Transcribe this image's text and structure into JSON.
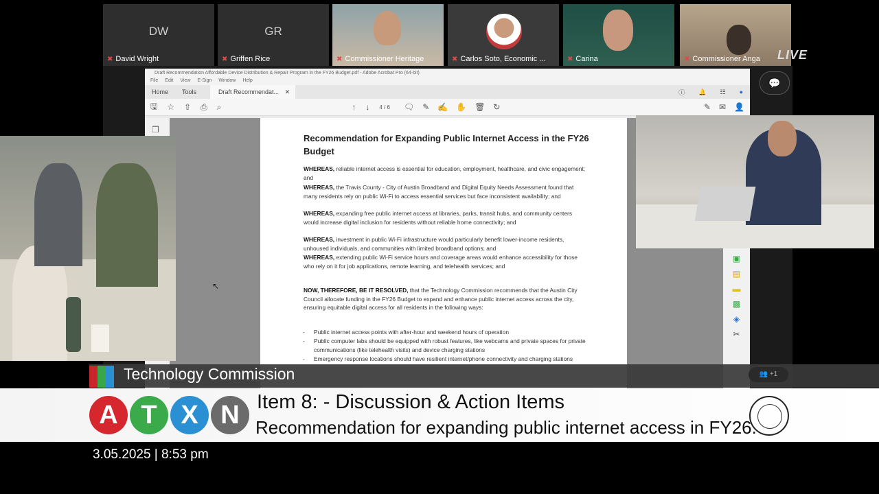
{
  "participants": [
    {
      "initials": "DW",
      "name": "David Wright"
    },
    {
      "initials": "GR",
      "name": "Griffen Rice"
    },
    {
      "initials": "",
      "name": "Commissioner Heritage"
    },
    {
      "initials": "",
      "name": "Carlos Soto, Economic ..."
    },
    {
      "initials": "",
      "name": "Carina"
    },
    {
      "initials": "",
      "name": "Commissioner Anga"
    }
  ],
  "live_label": "LIVE",
  "acrobat": {
    "window_title": "Draft Recommendation Affordable Device Distribution & Repair Program in the FY26 Budget.pdf - Adobe Acrobat Pro (64-bit)",
    "menu": [
      "File",
      "Edit",
      "View",
      "E-Sign",
      "Window",
      "Help"
    ],
    "tabs": {
      "home": "Home",
      "tools": "Tools",
      "doc": "Draft Recommendat..."
    },
    "page_indicator": "4 / 6"
  },
  "document": {
    "title": "Recommendation for Expanding Public Internet Access in the FY26 Budget",
    "whereas": [
      {
        "lead": "WHEREAS,",
        "text": " reliable internet access is essential for education, employment, healthcare, and civic engagement; and"
      },
      {
        "lead": "WHEREAS,",
        "text": " the Travis County - City of Austin Broadband and Digital Equity Needs Assessment found that many residents rely on public Wi-Fi to access essential services but face inconsistent availability; and"
      },
      {
        "lead": "WHEREAS,",
        "text": " expanding free public internet access at libraries, parks, transit hubs, and community centers would increase digital inclusion for residents without reliable home connectivity; and"
      },
      {
        "lead": "WHEREAS,",
        "text": " investment in public Wi-Fi infrastructure would particularly benefit lower-income residents, unhoused individuals, and communities with limited broadband options; and"
      },
      {
        "lead": "WHEREAS,",
        "text": " extending public Wi-Fi service hours and coverage areas would enhance accessibility for those who rely on it for job applications, remote learning, and telehealth services; and"
      }
    ],
    "resolved_lead": "NOW, THEREFORE, BE IT RESOLVED,",
    "resolved_text": " that the Technology Commission recommends that the Austin City Council allocate funding in the FY26 Budget to expand and enhance public internet access across the city, ensuring equitable digital access for all residents in the following ways:",
    "bullets": [
      "Public internet access points with after-hour and weekend hours of operation",
      "Public computer labs should be equipped with robust features, like webcams and private spaces for private communications (like telehealth visits) and device charging stations",
      "Emergency response locations should have resilient internet/phone connectivity and charging stations"
    ]
  },
  "lower_third": {
    "commission": "Technology Commission",
    "logo_letters": [
      "A",
      "T",
      "X",
      "N"
    ],
    "item_title": "Item 8: - Discussion & Action Items",
    "item_subtitle": "Recommendation for expanding public internet access in FY26.",
    "date_time": "3.05.2025 | 8:53 pm",
    "participant_count": "+1"
  },
  "colors": {
    "stripe1": "#c8262b",
    "stripe2": "#3aa64a",
    "stripe3": "#2a8fd3",
    "logo_a": "#d6262e",
    "logo_t": "#3aaa4b",
    "logo_x": "#2a8fd3",
    "logo_n": "#6b6b6b"
  }
}
